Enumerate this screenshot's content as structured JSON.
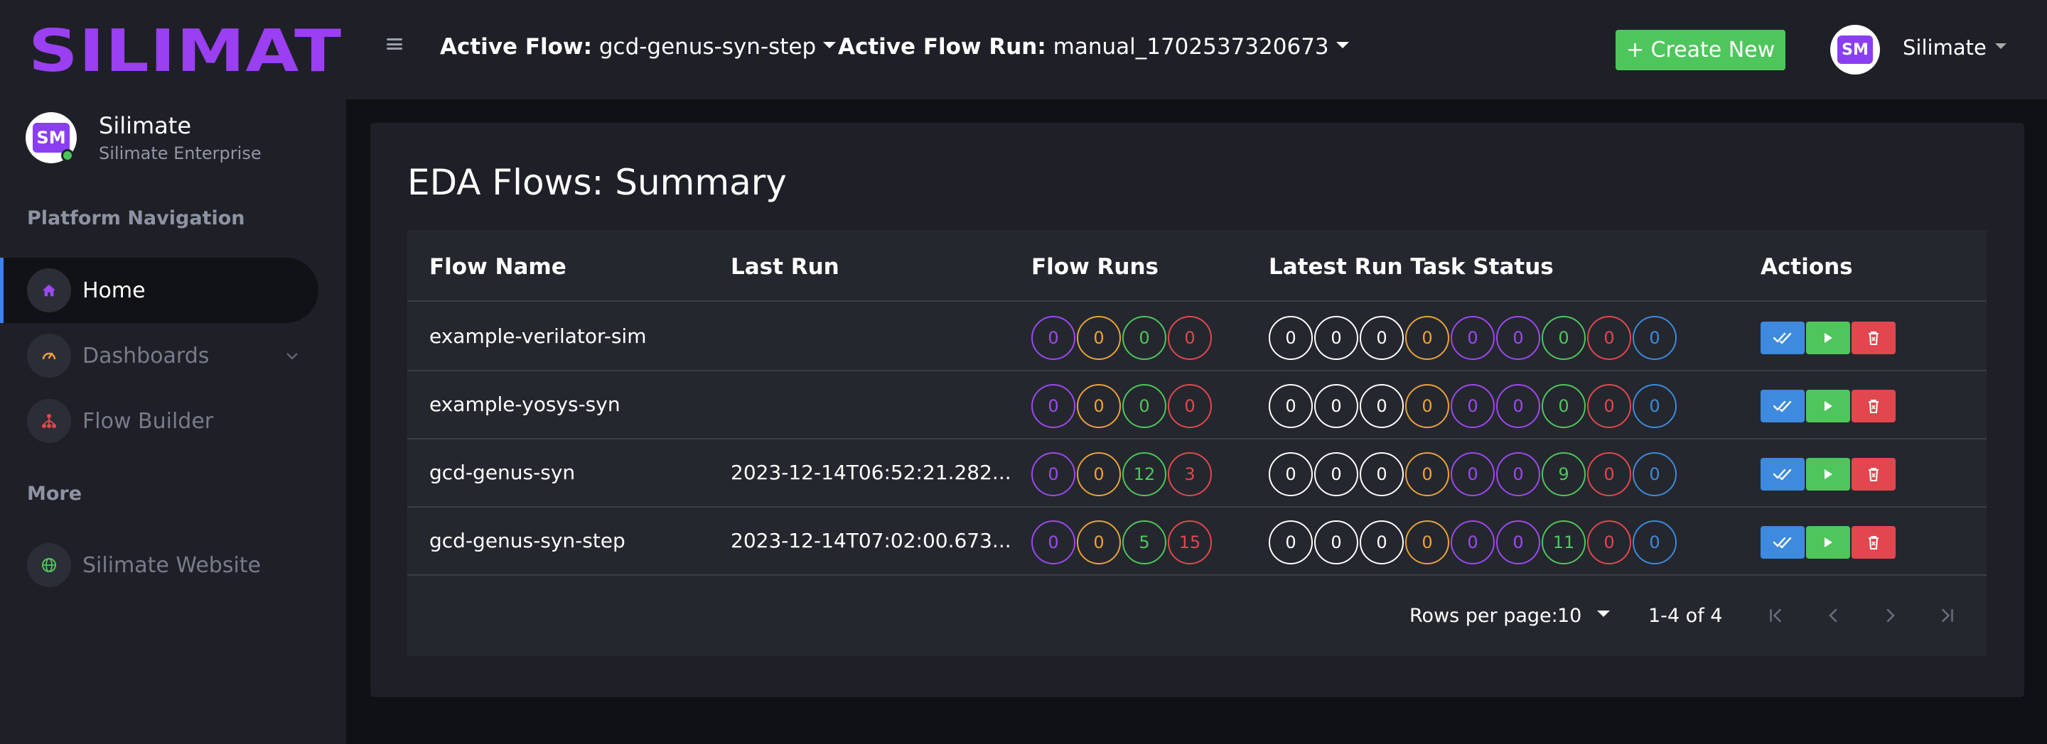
{
  "app": {
    "brand": "SILIMATE"
  },
  "sidebar": {
    "user": {
      "name": "Silimate",
      "org": "Silimate Enterprise",
      "avatar_text": "SM"
    },
    "nav_section_title": "Platform Navigation",
    "items": [
      {
        "label": "Home",
        "icon": "home-icon",
        "active": true
      },
      {
        "label": "Dashboards",
        "icon": "gauge-icon",
        "active": false
      },
      {
        "label": "Flow Builder",
        "icon": "flow-builder-icon",
        "active": false
      }
    ],
    "more_section_title": "More",
    "more_items": [
      {
        "label": "Silimate Website",
        "icon": "globe-icon"
      }
    ]
  },
  "topbar": {
    "active_flow_label": "Active Flow:",
    "active_flow_value": "gcd-genus-syn-step",
    "active_run_label": "Active Flow Run:",
    "active_run_value": "manual_1702537320673",
    "create_label": "+ Create New",
    "user_name": "Silimate",
    "avatar_text": "SM"
  },
  "main": {
    "title": "EDA Flows: Summary",
    "columns": [
      "Flow Name",
      "Last Run",
      "Flow Runs",
      "Latest Run Task Status",
      "Actions"
    ],
    "flow_run_colors": [
      "#9b49f0",
      "#e9a23b",
      "#4ec65c",
      "#e2474f"
    ],
    "task_status_colors": [
      "#ffffff",
      "#ffffff",
      "#ffffff",
      "#e9a23b",
      "#9b49f0",
      "#9b49f0",
      "#4ec65c",
      "#e2474f",
      "#3d8ade"
    ],
    "rows": [
      {
        "name": "example-verilator-sim",
        "last_run": "",
        "flow_runs": [
          "0",
          "0",
          "0",
          "0"
        ],
        "task_status": [
          "0",
          "0",
          "0",
          "0",
          "0",
          "0",
          "0",
          "0",
          "0"
        ]
      },
      {
        "name": "example-yosys-syn",
        "last_run": "",
        "flow_runs": [
          "0",
          "0",
          "0",
          "0"
        ],
        "task_status": [
          "0",
          "0",
          "0",
          "0",
          "0",
          "0",
          "0",
          "0",
          "0"
        ]
      },
      {
        "name": "gcd-genus-syn",
        "last_run": "2023-12-14T06:52:21.282...",
        "flow_runs": [
          "0",
          "0",
          "12",
          "3"
        ],
        "task_status": [
          "0",
          "0",
          "0",
          "0",
          "0",
          "0",
          "9",
          "0",
          "0"
        ]
      },
      {
        "name": "gcd-genus-syn-step",
        "last_run": "2023-12-14T07:02:00.673...",
        "flow_runs": [
          "0",
          "0",
          "5",
          "15"
        ],
        "task_status": [
          "0",
          "0",
          "0",
          "0",
          "0",
          "0",
          "11",
          "0",
          "0"
        ]
      }
    ],
    "pagination": {
      "rows_per_page_label": "Rows per page:",
      "rows_per_page_value": "10",
      "range": "1-4 of 4"
    }
  }
}
